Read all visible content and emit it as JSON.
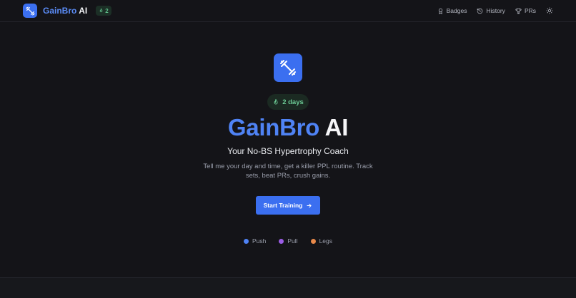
{
  "header": {
    "brand_primary": "GainBro",
    "brand_secondary": "AI",
    "streak_count": "2",
    "nav": [
      {
        "label": "Badges",
        "icon": "badge-icon"
      },
      {
        "label": "History",
        "icon": "history-icon"
      },
      {
        "label": "PRs",
        "icon": "trophy-icon"
      }
    ],
    "theme_toggle_icon": "sun-icon"
  },
  "hero": {
    "streak_label": "2 days",
    "title_primary": "GainBro",
    "title_secondary": "AI",
    "subtitle": "Your No-BS Hypertrophy Coach",
    "description": "Tell me your day and time, get a killer PPL routine. Track sets, beat PRs, crush gains.",
    "cta_label": "Start Training"
  },
  "legend": [
    {
      "label": "Push",
      "color": "#4f83f5"
    },
    {
      "label": "Pull",
      "color": "#9b5de5"
    },
    {
      "label": "Legs",
      "color": "#e8894a"
    }
  ],
  "colors": {
    "accent": "#3b6ff0",
    "streak_green": "#6ccb95",
    "background": "#141418"
  }
}
